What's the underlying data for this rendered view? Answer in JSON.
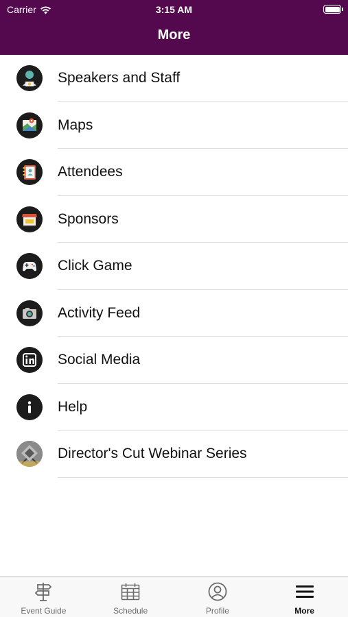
{
  "status_bar": {
    "carrier": "Carrier",
    "time": "3:15 AM"
  },
  "nav": {
    "title": "More"
  },
  "colors": {
    "header_bg": "#54084e",
    "icon_bg": "#1c1c1c",
    "tab_active": "#111111",
    "tab_inactive": "#6b6b6b"
  },
  "menu": {
    "items": [
      {
        "label": "Speakers and Staff",
        "icon": "speaker-person-icon"
      },
      {
        "label": "Maps",
        "icon": "map-pin-icon"
      },
      {
        "label": "Attendees",
        "icon": "contact-book-icon"
      },
      {
        "label": "Sponsors",
        "icon": "storefront-icon"
      },
      {
        "label": "Click Game",
        "icon": "gamepad-icon"
      },
      {
        "label": "Activity Feed",
        "icon": "camera-icon"
      },
      {
        "label": "Social Media",
        "icon": "linkedin-icon"
      },
      {
        "label": "Help",
        "icon": "info-icon"
      },
      {
        "label": "Director's Cut Webinar Series",
        "icon": "webinar-logo-icon"
      }
    ]
  },
  "tab_bar": {
    "tabs": [
      {
        "label": "Event Guide",
        "icon": "signpost-icon",
        "active": false
      },
      {
        "label": "Schedule",
        "icon": "calendar-icon",
        "active": false
      },
      {
        "label": "Profile",
        "icon": "profile-icon",
        "active": false
      },
      {
        "label": "More",
        "icon": "hamburger-menu-icon",
        "active": true
      }
    ]
  }
}
